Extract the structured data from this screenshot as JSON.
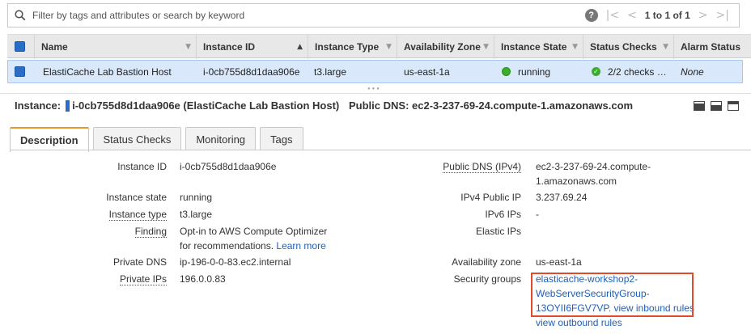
{
  "search": {
    "placeholder": "Filter by tags and attributes or search by keyword",
    "pagination": "1 to 1 of 1"
  },
  "table": {
    "columns": [
      "Name",
      "Instance ID",
      "Instance Type",
      "Availability Zone",
      "Instance State",
      "Status Checks",
      "Alarm Status"
    ],
    "row": {
      "name": "ElastiCache Lab Bastion Host",
      "instance_id": "i-0cb755d8d1daa906e",
      "instance_type": "t3.large",
      "availability_zone": "us-east-1a",
      "instance_state": "running",
      "status_checks": "2/2 checks …",
      "alarm_status": "None"
    }
  },
  "detail_header": {
    "instance_label": "Instance:",
    "instance_value": "i-0cb755d8d1daa906e (ElastiCache Lab Bastion Host)",
    "public_dns": "Public DNS: ec2-3-237-69-24.compute-1.amazonaws.com"
  },
  "tabs": [
    "Description",
    "Status Checks",
    "Monitoring",
    "Tags"
  ],
  "details_left": {
    "instance_id_label": "Instance ID",
    "instance_id": "i-0cb755d8d1daa906e",
    "instance_state_label": "Instance state",
    "instance_state": "running",
    "instance_type_label": "Instance type",
    "instance_type": "t3.large",
    "finding_label": "Finding",
    "finding_line1": "Opt-in to AWS Compute Optimizer",
    "finding_line2": "for recommendations.",
    "finding_link": "Learn more",
    "private_dns_label": "Private DNS",
    "private_dns": "ip-196-0-0-83.ec2.internal",
    "private_ips_label": "Private IPs",
    "private_ips": "196.0.0.83"
  },
  "details_right": {
    "public_dns_label": "Public DNS (IPv4)",
    "public_dns_line1": "ec2-3-237-69-24.compute-",
    "public_dns_line2": "1.amazonaws.com",
    "ipv4_label": "IPv4 Public IP",
    "ipv4": "3.237.69.24",
    "ipv6_label": "IPv6 IPs",
    "ipv6": "-",
    "elastic_label": "Elastic IPs",
    "az_label": "Availability zone",
    "az": "us-east-1a",
    "sg_label": "Security groups",
    "sg_line1": "elasticache-workshop2-",
    "sg_line2": "WebServerSecurityGroup-",
    "sg_line3": "13OYII6FGV7VP.",
    "sg_inbound": "view inbound rules",
    "sg_outbound": "view outbound rules"
  },
  "colors": {
    "accent": "#2a6dc7",
    "running": "#3aae2a",
    "tab_active_border": "#e7962a",
    "highlight": "#e24a2c",
    "link": "#1f5fb8"
  }
}
